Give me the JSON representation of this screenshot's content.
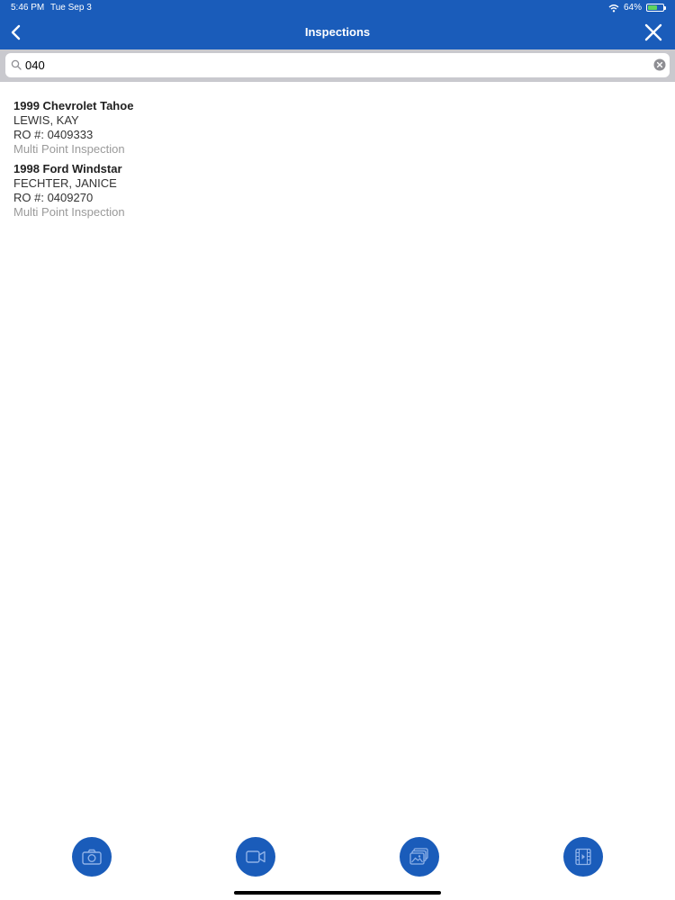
{
  "status": {
    "time": "5:46 PM",
    "date": "Tue Sep 3",
    "battery": "64%",
    "battery_level": 0.64
  },
  "nav": {
    "title": "Inspections"
  },
  "search": {
    "value": "040"
  },
  "results": [
    {
      "vehicle": "1999 Chevrolet Tahoe",
      "customer": "LEWIS, KAY",
      "ro": "RO #: 0409333",
      "type": "Multi Point Inspection"
    },
    {
      "vehicle": "1998 Ford Windstar",
      "customer": "FECHTER, JANICE",
      "ro": "RO #: 0409270",
      "type": "Multi Point Inspection"
    }
  ],
  "toolbar": {
    "buttons": [
      "camera-icon",
      "video-camera-icon",
      "photo-gallery-icon",
      "video-gallery-icon"
    ]
  },
  "colors": {
    "brand": "#1a5cba",
    "battery": "#5fd45f"
  }
}
